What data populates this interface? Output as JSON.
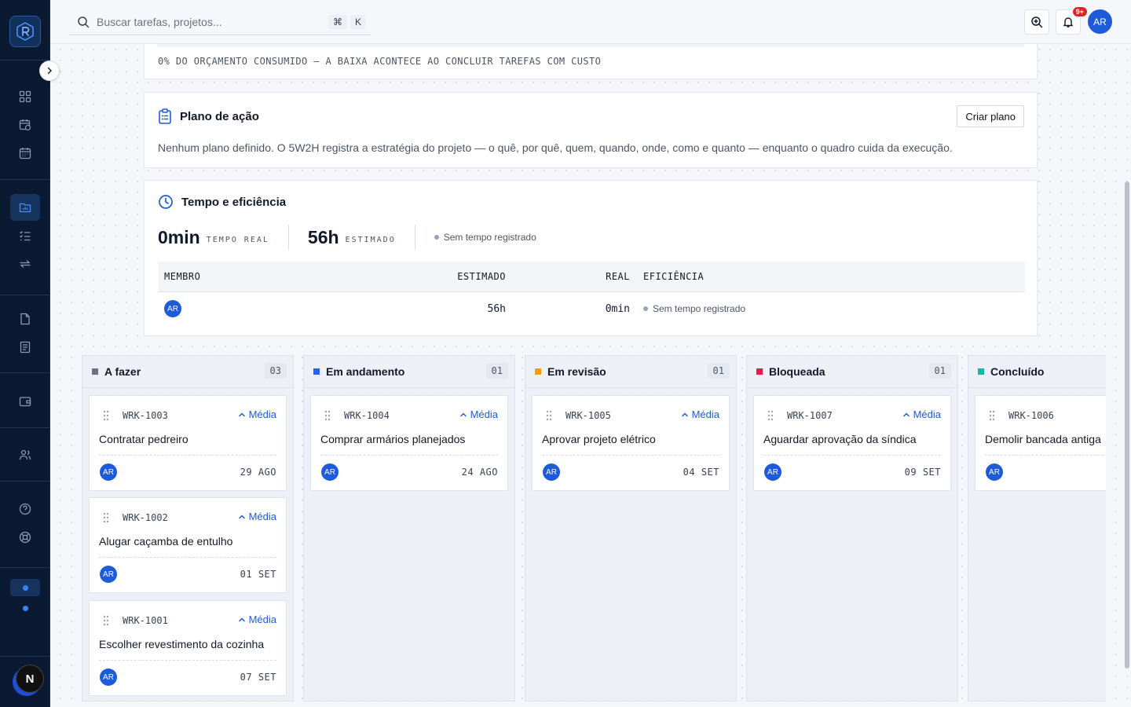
{
  "topbar": {
    "search_placeholder": "Buscar tarefas, projetos...",
    "shortcut_cmd": "⌘",
    "shortcut_key": "K",
    "notifications_count": "9+",
    "user_initials": "AR"
  },
  "budget": {
    "caption": "0% DO ORÇAMENTO CONSUMIDO — A BAIXA ACONTECE AO CONCLUIR TAREFAS COM CUSTO"
  },
  "action_plan": {
    "title": "Plano de ação",
    "button_label": "Criar plano",
    "description": "Nenhum plano definido. O 5W2H registra a estratégia do projeto — o quê, por quê, quem, quando, onde, como e quanto — enquanto o quadro cuida da execução."
  },
  "time": {
    "title": "Tempo e eficiência",
    "real_value": "0min",
    "real_label": "TEMPO REAL",
    "estimated_value": "56h",
    "estimated_label": "ESTIMADO",
    "status": "Sem tempo registrado",
    "table": {
      "headers": {
        "member": "MEMBRO",
        "estimated": "ESTIMADO",
        "real": "REAL",
        "efficiency": "EFICIÊNCIA"
      },
      "rows": [
        {
          "member": "AR",
          "estimated": "56h",
          "real": "0min",
          "efficiency": "Sem tempo registrado"
        }
      ]
    }
  },
  "board": {
    "columns": [
      {
        "name": "A fazer",
        "count": "03",
        "color": "#6b7280",
        "tasks": [
          {
            "code": "WRK-1003",
            "priority": "Média",
            "title": "Contratar pedreiro",
            "assignee": "AR",
            "date": "29 AGO"
          },
          {
            "code": "WRK-1002",
            "priority": "Média",
            "title": "Alugar caçamba de entulho",
            "assignee": "AR",
            "date": "01 SET"
          },
          {
            "code": "WRK-1001",
            "priority": "Média",
            "title": "Escolher revestimento da cozinha",
            "assignee": "AR",
            "date": "07 SET"
          }
        ]
      },
      {
        "name": "Em andamento",
        "count": "01",
        "color": "#2563eb",
        "tasks": [
          {
            "code": "WRK-1004",
            "priority": "Média",
            "title": "Comprar armários planejados",
            "assignee": "AR",
            "date": "24 AGO"
          }
        ]
      },
      {
        "name": "Em revisão",
        "count": "01",
        "color": "#f59e0b",
        "tasks": [
          {
            "code": "WRK-1005",
            "priority": "Média",
            "title": "Aprovar projeto elétrico",
            "assignee": "AR",
            "date": "04 SET"
          }
        ]
      },
      {
        "name": "Bloqueada",
        "count": "01",
        "color": "#e11d48",
        "tasks": [
          {
            "code": "WRK-1007",
            "priority": "Média",
            "title": "Aguardar aprovação da síndica",
            "assignee": "AR",
            "date": "09 SET"
          }
        ]
      },
      {
        "name": "Concluído",
        "count": "",
        "color": "#14b8a6",
        "tasks": [
          {
            "code": "WRK-1006",
            "priority": "",
            "title": "Demolir bancada antiga",
            "assignee": "AR",
            "date": ""
          }
        ]
      }
    ]
  },
  "sidebar": {
    "brand_letter": "N"
  }
}
